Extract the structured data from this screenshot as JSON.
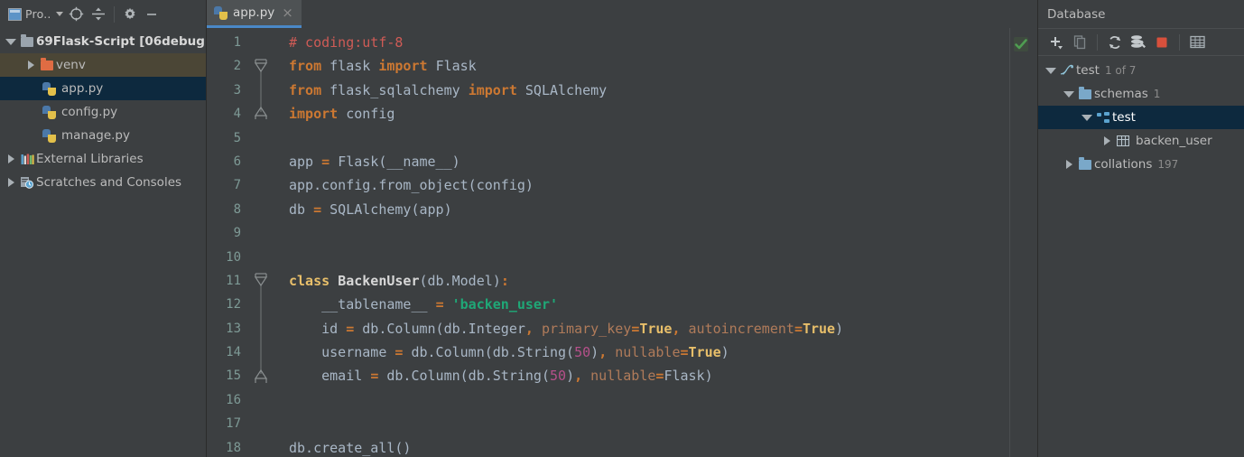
{
  "project_panel": {
    "toolbar": {
      "project_label": "Pro..",
      "project_icon": "project-window-icon",
      "caret_icon": "chevron-down-icon",
      "buttons": [
        {
          "name": "locate-icon",
          "title": "Select Opened File"
        },
        {
          "name": "collapse-all-icon",
          "title": "Collapse All"
        },
        {
          "name": "gear-icon",
          "title": "Settings"
        },
        {
          "name": "minimize-icon",
          "title": "Hide"
        }
      ]
    },
    "tree": [
      {
        "label": "69Flask-Script [06debug",
        "icon": "folder-gray-icon",
        "arrow": "expanded",
        "indent": 0,
        "bold_part": "[06debug",
        "state": "normal"
      },
      {
        "label": "venv",
        "icon": "folder-orange-icon",
        "arrow": "collapsed",
        "indent": 1,
        "state": "highlight"
      },
      {
        "label": "app.py",
        "icon": "python-file-icon",
        "arrow": "none",
        "indent": 2,
        "state": "selected"
      },
      {
        "label": "config.py",
        "icon": "python-file-icon",
        "arrow": "none",
        "indent": 2,
        "state": "normal"
      },
      {
        "label": "manage.py",
        "icon": "python-file-icon",
        "arrow": "none",
        "indent": 2,
        "state": "normal"
      },
      {
        "label": "External Libraries",
        "icon": "libraries-icon",
        "arrow": "collapsed",
        "indent": 0,
        "state": "normal"
      },
      {
        "label": "Scratches and Consoles",
        "icon": "scratches-icon",
        "arrow": "collapsed",
        "indent": 0,
        "state": "normal"
      }
    ]
  },
  "editor": {
    "tab": {
      "name": "app.py",
      "icon": "python-file-icon",
      "close_glyph": "×"
    },
    "inspection_badge": "green-check-icon",
    "line_numbers": [
      1,
      2,
      3,
      4,
      5,
      6,
      7,
      8,
      9,
      10,
      11,
      12,
      13,
      14,
      15,
      16,
      17,
      18
    ],
    "lines": [
      {
        "n": 1,
        "tokens": [
          {
            "t": "# coding:utf-8",
            "c": "cmt"
          }
        ]
      },
      {
        "n": 2,
        "tokens": [
          {
            "t": "from ",
            "c": "kw"
          },
          {
            "t": "flask ",
            "c": "pl"
          },
          {
            "t": "import ",
            "c": "kw"
          },
          {
            "t": "Flask",
            "c": "pl"
          }
        ]
      },
      {
        "n": 3,
        "tokens": [
          {
            "t": "from ",
            "c": "kw"
          },
          {
            "t": "flask_sqlalchemy ",
            "c": "pl"
          },
          {
            "t": "import ",
            "c": "kw"
          },
          {
            "t": "SQLAlchemy",
            "c": "pl"
          }
        ]
      },
      {
        "n": 4,
        "tokens": [
          {
            "t": "import ",
            "c": "kw"
          },
          {
            "t": "config",
            "c": "pl"
          }
        ]
      },
      {
        "n": 5,
        "tokens": []
      },
      {
        "n": 6,
        "tokens": [
          {
            "t": "app ",
            "c": "pl"
          },
          {
            "t": "= ",
            "c": "kw"
          },
          {
            "t": "Flask(__name__)",
            "c": "pl"
          }
        ]
      },
      {
        "n": 7,
        "tokens": [
          {
            "t": "app.config.from_object(config)",
            "c": "pl"
          }
        ]
      },
      {
        "n": 8,
        "tokens": [
          {
            "t": "db ",
            "c": "pl"
          },
          {
            "t": "= ",
            "c": "kw"
          },
          {
            "t": "SQLAlchemy(app)",
            "c": "pl"
          }
        ]
      },
      {
        "n": 9,
        "tokens": []
      },
      {
        "n": 10,
        "tokens": []
      },
      {
        "n": 11,
        "tokens": [
          {
            "t": "class ",
            "c": "kwy"
          },
          {
            "t": "BackenUser",
            "c": "cls"
          },
          {
            "t": "(db.Model)",
            "c": "pl"
          },
          {
            "t": ":",
            "c": "kw"
          }
        ]
      },
      {
        "n": 12,
        "tokens": [
          {
            "t": "    __tablename__ ",
            "c": "pl"
          },
          {
            "t": "= ",
            "c": "kw"
          },
          {
            "t": "'backen_user'",
            "c": "str"
          }
        ]
      },
      {
        "n": 13,
        "tokens": [
          {
            "t": "    id ",
            "c": "pl"
          },
          {
            "t": "= ",
            "c": "kw"
          },
          {
            "t": "db.Column(db.Integer",
            "c": "pl"
          },
          {
            "t": ", ",
            "c": "kw"
          },
          {
            "t": "primary_key",
            "c": "kwarg"
          },
          {
            "t": "=",
            "c": "kw"
          },
          {
            "t": "True",
            "c": "kwy"
          },
          {
            "t": ", ",
            "c": "kw"
          },
          {
            "t": "autoincrement",
            "c": "kwarg"
          },
          {
            "t": "=",
            "c": "kw"
          },
          {
            "t": "True",
            "c": "kwy"
          },
          {
            "t": ")",
            "c": "pl"
          }
        ]
      },
      {
        "n": 14,
        "tokens": [
          {
            "t": "    username ",
            "c": "pl"
          },
          {
            "t": "= ",
            "c": "kw"
          },
          {
            "t": "db.Column(db.String(",
            "c": "pl"
          },
          {
            "t": "50",
            "c": "num"
          },
          {
            "t": ")",
            "c": "pl"
          },
          {
            "t": ", ",
            "c": "kw"
          },
          {
            "t": "nullable",
            "c": "kwarg"
          },
          {
            "t": "=",
            "c": "kw"
          },
          {
            "t": "True",
            "c": "kwy"
          },
          {
            "t": ")",
            "c": "pl"
          }
        ]
      },
      {
        "n": 15,
        "tokens": [
          {
            "t": "    email ",
            "c": "pl"
          },
          {
            "t": "= ",
            "c": "kw"
          },
          {
            "t": "db.Column(db.String(",
            "c": "pl"
          },
          {
            "t": "50",
            "c": "num"
          },
          {
            "t": ")",
            "c": "pl"
          },
          {
            "t": ", ",
            "c": "kw"
          },
          {
            "t": "nullable",
            "c": "kwarg"
          },
          {
            "t": "=",
            "c": "kw"
          },
          {
            "t": "Flask)",
            "c": "pl"
          }
        ]
      },
      {
        "n": 16,
        "tokens": []
      },
      {
        "n": 17,
        "tokens": []
      },
      {
        "n": 18,
        "tokens": [
          {
            "t": "db.create_all()",
            "c": "pl"
          }
        ]
      }
    ]
  },
  "database_panel": {
    "title": "Database",
    "toolbar": [
      {
        "name": "add-icon",
        "title": "New"
      },
      {
        "name": "copy-icon",
        "title": "Duplicate"
      },
      {
        "name": "refresh-icon",
        "title": "Synchronize"
      },
      {
        "name": "db-tools-icon",
        "title": "Data Source Properties"
      },
      {
        "name": "stop-icon",
        "title": "Stop"
      },
      {
        "name": "table-icon",
        "title": "Open Console"
      }
    ],
    "tree": [
      {
        "label": "test",
        "count": "1 of 7",
        "icon": "mysql-icon",
        "arrow": "expanded",
        "indent": 0,
        "state": "normal"
      },
      {
        "label": "schemas",
        "count": "1",
        "icon": "folder-blue-icon",
        "arrow": "expanded",
        "indent": 1,
        "state": "normal"
      },
      {
        "label": "test",
        "count": "",
        "icon": "schema-icon",
        "arrow": "expanded",
        "indent": 2,
        "state": "selected"
      },
      {
        "label": "backen_user",
        "count": "",
        "icon": "table-grid-icon",
        "arrow": "collapsed",
        "indent": 3,
        "state": "normal"
      },
      {
        "label": "collations",
        "count": "197",
        "icon": "folder-blue-icon",
        "arrow": "collapsed",
        "indent": 1,
        "state": "normal"
      }
    ]
  },
  "colors": {
    "bg_panel": "#3c3f41",
    "bg_editor": "#3c3f41",
    "selection_blue": "#0d293e",
    "selection_olive": "#4b4636",
    "tab_active_underline": "#4a88c7",
    "keyword_orange": "#cc7832",
    "string_green": "#1fa877",
    "comment_red": "#cf5b56",
    "number_magenta": "#b5508a",
    "kwarg_brown": "#b07b5a",
    "text_default": "#a9b7c6",
    "linenumber": "#7e9a96",
    "stop_red": "#d8503c"
  }
}
